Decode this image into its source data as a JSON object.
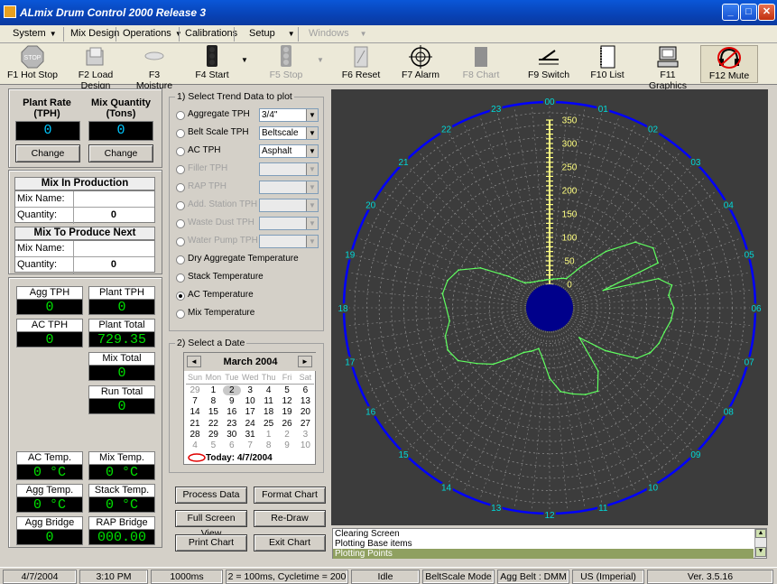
{
  "window": {
    "title": "ALmix Drum Control 2000 Release 3"
  },
  "menu": [
    {
      "label": "System",
      "arrow": "▼"
    },
    {
      "label": "Mix Design",
      "arrow": ""
    },
    {
      "label": "Operations",
      "arrow": "▼"
    },
    {
      "label": "Calibrations",
      "arrow": ""
    },
    {
      "label": "Setup",
      "arrow": "▼"
    },
    {
      "label": "Windows",
      "arrow": "▼"
    }
  ],
  "toolbar": [
    {
      "label": "F1 Hot Stop",
      "icon": "stop-sign-icon"
    },
    {
      "label": "F2 Load Design",
      "icon": "folder-icon"
    },
    {
      "label": "F3 Moisture",
      "icon": "cloud-icon"
    },
    {
      "label": "F4 Start",
      "icon": "traffic-light-icon"
    },
    {
      "label": "F5 Stop",
      "icon": "traffic-light-icon"
    },
    {
      "label": "F6 Reset",
      "icon": "reset-icon"
    },
    {
      "label": "F7 Alarm",
      "icon": "crosshair-icon"
    },
    {
      "label": "F8 Chart",
      "icon": "chart-icon"
    },
    {
      "label": "F9 Switch",
      "icon": "switch-icon"
    },
    {
      "label": "F10 List",
      "icon": "list-icon"
    },
    {
      "label": "F11 Graphics",
      "icon": "computer-icon"
    },
    {
      "label": "F12 Mute",
      "icon": "mute-icon"
    }
  ],
  "rates": {
    "plant_rate_label": "Plant Rate",
    "plant_rate_unit": "(TPH)",
    "plant_rate_value": "0",
    "mix_qty_label": "Mix Quantity",
    "mix_qty_unit": "(Tons)",
    "mix_qty_value": "0",
    "change_label": "Change"
  },
  "mix_in_production": {
    "title": "Mix In Production",
    "name_label": "Mix Name:",
    "name_value": "",
    "qty_label": "Quantity:",
    "qty_value": "0"
  },
  "mix_next": {
    "title": "Mix To Produce Next",
    "name_label": "Mix Name:",
    "name_value": "",
    "qty_label": "Quantity:",
    "qty_value": "0"
  },
  "readings": {
    "agg_tph": {
      "label": "Agg TPH",
      "value": "0"
    },
    "plant_tph": {
      "label": "Plant TPH",
      "value": "0"
    },
    "ac_tph": {
      "label": "AC TPH",
      "value": "0"
    },
    "plant_total": {
      "label": "Plant Total",
      "value": "729.35"
    },
    "mix_total": {
      "label": "Mix Total",
      "value": "0"
    },
    "run_total": {
      "label": "Run Total",
      "value": "0"
    },
    "ac_temp": {
      "label": "AC Temp.",
      "value": "0 °C"
    },
    "mix_temp": {
      "label": "Mix Temp.",
      "value": "0 °C"
    },
    "agg_temp": {
      "label": "Agg Temp.",
      "value": "0 °C"
    },
    "stack_temp": {
      "label": "Stack Temp.",
      "value": "0 °C"
    },
    "agg_bridge": {
      "label": "Agg Bridge",
      "value": "0"
    },
    "rap_bridge": {
      "label": "RAP Bridge",
      "value": "000.00"
    }
  },
  "trend": {
    "title": "1) Select Trend Data to plot",
    "options": [
      {
        "label": "Aggregate TPH",
        "combo": "3/4\"",
        "enabled": true,
        "selected": false
      },
      {
        "label": "Belt Scale TPH",
        "combo": "Beltscale",
        "enabled": true,
        "selected": false
      },
      {
        "label": "AC TPH",
        "combo": "Asphalt",
        "enabled": true,
        "selected": false
      },
      {
        "label": "Filler TPH",
        "combo": "",
        "enabled": false,
        "selected": false
      },
      {
        "label": "RAP TPH",
        "combo": "",
        "enabled": false,
        "selected": false
      },
      {
        "label": "Add. Station TPH",
        "combo": "",
        "enabled": false,
        "selected": false
      },
      {
        "label": "Waste Dust TPH",
        "combo": "",
        "enabled": false,
        "selected": false
      },
      {
        "label": "Water Pump TPH",
        "combo": "",
        "enabled": false,
        "selected": false
      },
      {
        "label": "Dry Aggregate  Temperature",
        "enabled": true,
        "selected": false
      },
      {
        "label": "Stack Temperature",
        "enabled": true,
        "selected": false
      },
      {
        "label": "AC Temperature",
        "enabled": true,
        "selected": true
      },
      {
        "label": "Mix Temperature",
        "enabled": true,
        "selected": false
      }
    ]
  },
  "date": {
    "title": "2) Select a Date",
    "month": "March 2004",
    "weekdays": [
      "Sun",
      "Mon",
      "Tue",
      "Wed",
      "Thu",
      "Fri",
      "Sat"
    ],
    "weeks": [
      [
        "29",
        "1",
        "2",
        "3",
        "4",
        "5",
        "6"
      ],
      [
        "7",
        "8",
        "9",
        "10",
        "11",
        "12",
        "13"
      ],
      [
        "14",
        "15",
        "16",
        "17",
        "18",
        "19",
        "20"
      ],
      [
        "21",
        "22",
        "23",
        "24",
        "25",
        "26",
        "27"
      ],
      [
        "28",
        "29",
        "30",
        "31",
        "1",
        "2",
        "3"
      ],
      [
        "4",
        "5",
        "6",
        "7",
        "8",
        "9",
        "10"
      ]
    ],
    "selected": "2",
    "today": "Today: 4/7/2004"
  },
  "actions": {
    "process": "Process Data",
    "format": "Format Chart",
    "fullscreen": "Full Screen View",
    "redraw": "Re-Draw",
    "print": "Print Chart",
    "exit": "Exit Chart"
  },
  "chart_data": {
    "type": "line",
    "polar": true,
    "hour_labels": [
      "00",
      "01",
      "02",
      "03",
      "04",
      "05",
      "06",
      "07",
      "08",
      "09",
      "10",
      "11",
      "12",
      "13",
      "14",
      "15",
      "16",
      "17",
      "18",
      "19",
      "20",
      "21",
      "22",
      "23"
    ],
    "radial_ticks": [
      "0",
      "50",
      "100",
      "150",
      "200",
      "250",
      "300",
      "350"
    ],
    "rmax": 350,
    "colors": {
      "background": "#3c3c3c",
      "grid": "#8a8a8a",
      "outer_ring": "#0000ff",
      "hub": "#00008b",
      "trace": "#60ff60",
      "labels": "#00d8d8",
      "ticks": "#ffff80"
    },
    "series": [
      {
        "hours": [
          0,
          0.5,
          1,
          1.5,
          2,
          2.5,
          3,
          3.5,
          4,
          4.5,
          4.8,
          5.0,
          5.3,
          5.6,
          6,
          6.4,
          6.8,
          7.2,
          7.6,
          8,
          8.5,
          9,
          9.5,
          10,
          10.5,
          11,
          11.5,
          12,
          12.5,
          13,
          13.5,
          14,
          14.5,
          15,
          15.5,
          16,
          16.5,
          17,
          17.5,
          18,
          18.5,
          19,
          19.5,
          20,
          20.5,
          21,
          21.5,
          22,
          22.5,
          23,
          23.5
        ],
        "values": [
          10,
          12,
          14,
          18,
          22,
          60,
          120,
          180,
          205,
          200,
          70,
          190,
          215,
          205,
          215,
          210,
          200,
          195,
          185,
          165,
          100,
          40,
          120,
          155,
          150,
          140,
          130,
          100,
          60,
          40,
          50,
          60,
          85,
          120,
          145,
          175,
          185,
          180,
          165,
          170,
          180,
          175,
          160,
          120,
          60,
          25,
          18,
          14,
          12,
          10,
          10
        ]
      }
    ]
  },
  "log": [
    "Clearing Screen",
    "Plotting Base items",
    "Plotting Points"
  ],
  "status": [
    "4/7/2004",
    "3:10 PM",
    "1000ms",
    "2 = 100ms, Cycletime = 200",
    "Idle",
    "BeltScale Mode",
    "Agg Belt : DMM",
    "US (Imperial)",
    "Ver. 3.5.16"
  ]
}
